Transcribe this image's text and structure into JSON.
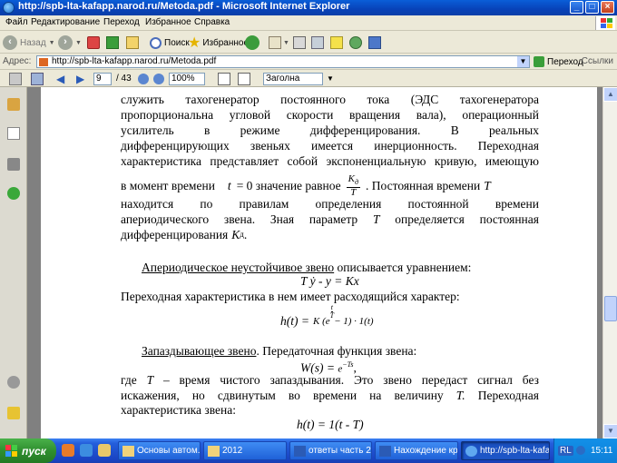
{
  "window": {
    "title": "http://spb-lta-kafapp.narod.ru/Metoda.pdf - Microsoft Internet Explorer",
    "minimize": "_",
    "maximize": "□",
    "close": "×"
  },
  "menu": {
    "items": [
      "Файл",
      "Редактирование",
      "Переход",
      "Избранное",
      "Справка"
    ]
  },
  "toolbar": {
    "back_label": "Назад",
    "search_label": "Поиск",
    "favorites_label": "Избранное"
  },
  "address": {
    "label": "Адрес:",
    "value": "http://spb-lta-kafapp.narod.ru/Metoda.pdf",
    "go_label": "Переход",
    "links_label": "Ссылки"
  },
  "pdf_toolbar": {
    "page_current": "9",
    "page_total": "/ 43",
    "zoom": "100%",
    "find_value": "Заголна"
  },
  "document": {
    "lines": [
      [
        "служить",
        "тахогенератор",
        "постоянного",
        "тока",
        "(ЭДС",
        "тахогенератора"
      ],
      [
        "пропорциональна",
        "угловой",
        "скорости",
        "вращения",
        "вала),",
        "операционный"
      ],
      [
        "усилитель",
        "в",
        "режиме",
        "дифференцирования.",
        "В",
        "реальных"
      ],
      [
        "дифференцирующих",
        "звеньях",
        "имеется",
        "инерционность.",
        "Переходная"
      ],
      [
        "характеристика",
        "представляет",
        "собой",
        "экспоненциальную",
        "кривую,",
        "имеющую"
      ]
    ],
    "moment_line": {
      "pre": "в момент времени",
      "t": "t",
      "eq": "= 0 значение равное",
      "frac_num": "K",
      "frac_num_sub": "д",
      "frac_den": "T",
      "post": ". Постоянная времени",
      "post_var": "T"
    },
    "lines2": [
      [
        "находится",
        "по",
        "правилам",
        "определения",
        "постоянной",
        "времени"
      ],
      [
        "апериодического",
        "звена.",
        "Зная",
        "параметр",
        "T",
        "определяется",
        "постоянная"
      ]
    ],
    "line_last": {
      "pre": "дифференцирования",
      "var": "K",
      "sub": "д",
      "post": "."
    },
    "aperiodic_heading_u": "Апериодическое неустойчивое звено",
    "aperiodic_heading_rest": " описывается уравнением:",
    "aperiodic_eq": "T ẏ  - y = Kx",
    "transient_text": "Переходная характеристика в нем имеет расходящийся характер:",
    "h_eq_left": "h(t) = ",
    "h_eq_right_pre": "K (e",
    "h_eq_exp_num": "t",
    "h_eq_exp_den": "T",
    "h_eq_right_post": " − 1) · 1(t)",
    "delay_heading_u": "Запаздывающее звено",
    "delay_heading_rest": ". Передаточная функция звена:",
    "w_eq_left": "W(s) = ",
    "w_eq_base": "e",
    "w_eq_exp": "−Ts",
    "w_eq_post": ",",
    "lines3": [
      [
        "где",
        "T",
        "–",
        "время",
        "чистого",
        "запаздывания.",
        "Это",
        "звено",
        "передаст",
        "сигнал",
        "без"
      ],
      [
        "искажения,",
        "но",
        "сдвинутым",
        "во",
        "времени",
        "на",
        "величину",
        "T.",
        "Переходная"
      ]
    ],
    "last_text": "характеристика звена:",
    "last_eq": "h(t) = 1(t - T)"
  },
  "taskbar": {
    "start_label": "пуск",
    "tasks": [
      "Основы автом.п...",
      "2012",
      "ответы часть 2 ...",
      "Нахождение кри...",
      "http://spb-lta-kafap..."
    ],
    "lang": "RL",
    "clock": "15:11"
  },
  "colors": {
    "titlebar": "#0a4fc8",
    "taskbar": "#245edb",
    "start": "#2f8f2f",
    "page_bg": "#ffffff",
    "viewer_bg": "#808080"
  }
}
